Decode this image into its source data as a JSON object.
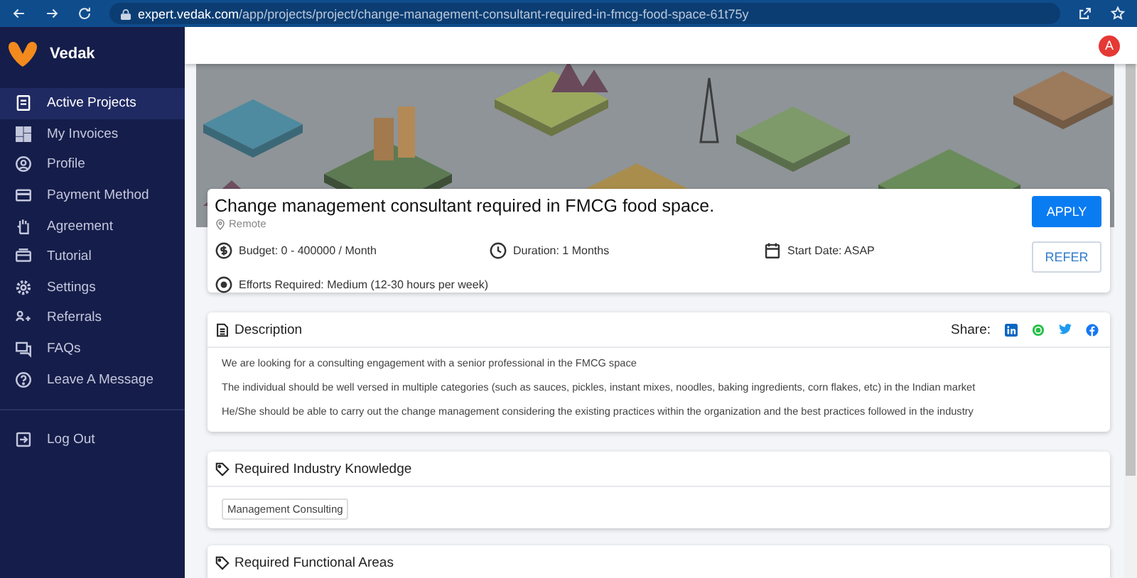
{
  "browser": {
    "url": "expert.vedak.com/app/projects/project/change-management-consultant-required-in-fmcg-food-space-61t75y"
  },
  "sidebar": {
    "brand": "Vedak",
    "items": [
      {
        "label": "Active Projects",
        "selected": true
      },
      {
        "label": "My Invoices",
        "selected": false
      },
      {
        "label": "Profile",
        "selected": false
      },
      {
        "label": "Payment Method",
        "selected": false
      },
      {
        "label": "Agreement",
        "selected": false
      },
      {
        "label": "Tutorial",
        "selected": false
      },
      {
        "label": "Settings",
        "selected": false
      },
      {
        "label": "Referrals",
        "selected": false
      },
      {
        "label": "FAQs",
        "selected": false
      },
      {
        "label": "Leave A Message",
        "selected": false
      }
    ],
    "footer_items": [
      {
        "label": "Log Out"
      }
    ]
  },
  "header": {
    "avatar": "A"
  },
  "project": {
    "title": "Change management consultant required in FMCG food space.",
    "location": "Remote",
    "details": [
      {
        "kind": "budget",
        "text": "Budget: 0 - 400000 / Month"
      },
      {
        "kind": "duration",
        "text": "Duration: 1 Months"
      },
      {
        "kind": "start",
        "text": "Start Date: ASAP"
      },
      {
        "kind": "effort",
        "text": "Efforts Required: Medium (12-30 hours per week)"
      }
    ],
    "buttons": [
      {
        "kind": "primary",
        "label": "APPLY"
      },
      {
        "kind": "outline",
        "label": "REFER"
      }
    ]
  },
  "sections": [
    {
      "kind": "description",
      "title": "Description",
      "share_label": "Share:",
      "paragraphs": [
        "We are looking for a consulting engagement with a senior professional in the FMCG space",
        "The individual should be well versed in multiple categories (such as sauces, pickles, instant mixes, noodles, baking ingredients, corn flakes, etc) in the Indian market",
        "He/She should be able to carry out the change management considering the existing practices within the organization and the best practices followed in the industry"
      ]
    },
    {
      "kind": "tags",
      "title": "Required Industry Knowledge",
      "tags": [
        "Management Consulting"
      ]
    },
    {
      "kind": "tags",
      "title": "Required Functional Areas"
    }
  ]
}
